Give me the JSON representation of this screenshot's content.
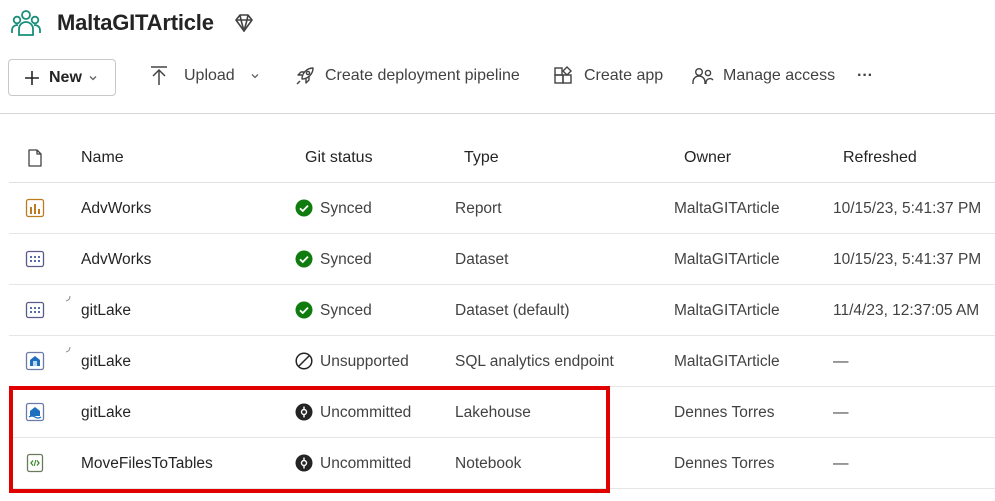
{
  "workspace": {
    "title": "MaltaGITArticle",
    "icon": "workspace-people-icon",
    "premium_icon": "diamond-icon"
  },
  "toolbar": {
    "new_label": "New",
    "upload_label": "Upload",
    "deployment_label": "Create deployment pipeline",
    "create_app_label": "Create app",
    "manage_access_label": "Manage access",
    "more_label": "···"
  },
  "table": {
    "headers": {
      "name": "Name",
      "git_status": "Git status",
      "type": "Type",
      "owner": "Owner",
      "refreshed": "Refreshed"
    },
    "rows": [
      {
        "icon": "report-icon",
        "name": "AdvWorks",
        "status_icon": "synced-check-icon",
        "git_status": "Synced",
        "type": "Report",
        "owner": "MaltaGITArticle",
        "refreshed": "10/15/23, 5:41:37 PM"
      },
      {
        "icon": "dataset-icon",
        "name": "AdvWorks",
        "status_icon": "synced-check-icon",
        "git_status": "Synced",
        "type": "Dataset",
        "owner": "MaltaGITArticle",
        "refreshed": "10/15/23, 5:41:37 PM"
      },
      {
        "icon": "dataset-icon",
        "name": "gitLake",
        "status_icon": "synced-check-icon",
        "git_status": "Synced",
        "type": "Dataset (default)",
        "owner": "MaltaGITArticle",
        "refreshed": "11/4/23, 12:37:05 AM"
      },
      {
        "icon": "sql-endpoint-icon",
        "name": "gitLake",
        "status_icon": "unsupported-icon",
        "git_status": "Unsupported",
        "type": "SQL analytics endpoint",
        "owner": "MaltaGITArticle",
        "refreshed": "—"
      },
      {
        "icon": "lakehouse-icon",
        "name": "gitLake",
        "status_icon": "uncommitted-icon",
        "git_status": "Uncommitted",
        "type": "Lakehouse",
        "owner": "Dennes Torres",
        "refreshed": "—"
      },
      {
        "icon": "notebook-icon",
        "name": "MoveFilesToTables",
        "status_icon": "uncommitted-icon",
        "git_status": "Uncommitted",
        "type": "Notebook",
        "owner": "Dennes Torres",
        "refreshed": "—"
      }
    ]
  },
  "colors": {
    "synced": "#107c10",
    "highlight": "#e00000",
    "report_icon": "#c07a1e",
    "item_icon_blue": "#1f6fbf"
  }
}
